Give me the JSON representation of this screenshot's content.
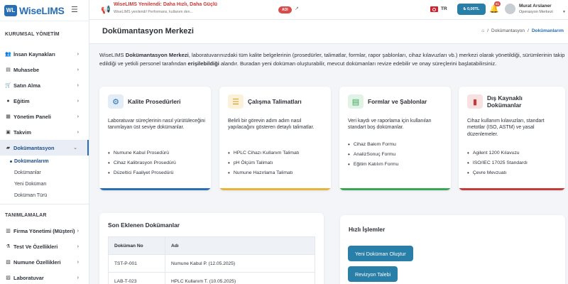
{
  "app": {
    "logo_badge": "WL",
    "logo_name": "WiseLIMS"
  },
  "sidebar": {
    "section1": "KURUMSAL YÖNETİM",
    "items1": [
      {
        "label": "İnsan Kaynakları",
        "icon": "users-icon"
      },
      {
        "label": "Muhasebe",
        "icon": "calculator-icon"
      },
      {
        "label": "Satın Alma",
        "icon": "cart-icon"
      },
      {
        "label": "Eğitim",
        "icon": "graduation-icon"
      },
      {
        "label": "Yönetim Paneli",
        "icon": "panel-icon"
      },
      {
        "label": "Takvim",
        "icon": "calendar-icon"
      },
      {
        "label": "Dokümantasyon",
        "icon": "folder-icon"
      }
    ],
    "subitems": [
      "Dokümanlarım",
      "Dokümanlar",
      "Yeni Doküman",
      "Doküman Türü"
    ],
    "section2": "TANIMLAMALAR",
    "items2": [
      {
        "label": "Firma Yönetimi (Müşteri)",
        "icon": "building-icon"
      },
      {
        "label": "Test Ve Özellikleri",
        "icon": "flask-icon"
      },
      {
        "label": "Numune Özellikleri",
        "icon": "sample-icon"
      },
      {
        "label": "Laboratuvar",
        "icon": "lab-icon"
      }
    ]
  },
  "topbar": {
    "announcement_title": "WiseLIMS Yenilendi: Daha Hızlı, Daha Güçlü",
    "announcement_sub": "WiseLIMS yenilendi! Performans, kullanım den...",
    "announcement_badge": "ADI",
    "announcement_link": "↗",
    "language": "TR",
    "money_label": "₺ 0,00TL",
    "notification_count": "61",
    "user_name": "Murat Arslaner",
    "user_role": "Operasyon Merkezi"
  },
  "page": {
    "title": "Dokümantasyon Merkezi",
    "breadcrumb_mid": "Dokümantasyon",
    "breadcrumb_current": "Dokümanlarım",
    "intro_a": "WiseLIMS ",
    "intro_b": "Dokümantasyon Merkezi",
    "intro_c": ", laboratuvarınızdaki tüm kalite belgelerinin (prosedürler, talimatlar, formlar, rapor şablonları, cihaz kılavuzları vb.) merkezi olarak yönetildiği, sürümlerinin takip edildiği ve yetkili personel tarafından ",
    "intro_d": "erişilebildiği",
    "intro_e": " alandır. Buradan yeni doküman oluşturabilir, mevcut dokümanları revize edebilir ve onay süreçlerini başlatabilirsiniz."
  },
  "cards": [
    {
      "title": "Kalite Prosedürleri",
      "icon": "gear-icon",
      "desc": "Laboratuvar süreçlerinin nasıl yürütüleceğini tanımlayan üst seviye dokümanlar.",
      "items": [
        "Numune Kabul Prosedürü",
        "Cihaz Kalibrasyon Prosedürü",
        "Düzeltici Faaliyet Prosedürü"
      ],
      "color": "#2a6fb5"
    },
    {
      "title": "Çalışma Talimatları",
      "icon": "checklist-icon",
      "desc": "Belirli bir görevin adım adım nasıl yapılacağını gösteren detaylı talimatlar.",
      "items": [
        "HPLC Cihazı Kullanım Talimatı",
        "pH Ölçüm Talimatı",
        "Numune Hazırlama Talimatı"
      ],
      "color": "#e8b33a"
    },
    {
      "title": "Formlar ve Şablonlar",
      "icon": "form-icon",
      "desc": "Veri kaydı ve raporlama için kullanılan standart boş dokümanlar.",
      "items": [
        "Cihaz Bakım Formu",
        "AnalizSonuç Formu",
        "Eğitim Katılım Formu"
      ],
      "color": "#3aa655"
    },
    {
      "title": "Dış Kaynaklı Dokümanlar",
      "icon": "book-icon",
      "desc": "Cihaz kullanım kılavuzları, standart metotlar (ISO, ASTM) ve yasal düzenlemeler.",
      "items": [
        "Agilent 1200 Kılavuzu",
        "ISO/IEC 17025 Standardı",
        "Çevre Mevzuatı"
      ],
      "color": "#c73a3a"
    }
  ],
  "latest": {
    "title": "Son Eklenen Dokümanlar",
    "col1": "Doküman No",
    "col2": "Adı",
    "rows": [
      [
        "TST-P-001",
        "Numune Kabul P. (12.05.2025)"
      ],
      [
        "LAB-T-023",
        "HPLC Kullanım T. (10.05.2025)"
      ]
    ]
  },
  "quick": {
    "title": "Hızlı İşlemler",
    "btn1": "Yeni Doküman Oluştur",
    "btn2": "Revizyon Talebi"
  },
  "colors": {
    "primary": "#2a6fb5",
    "button": "#2a7fa8",
    "alert": "#c73a3a"
  }
}
